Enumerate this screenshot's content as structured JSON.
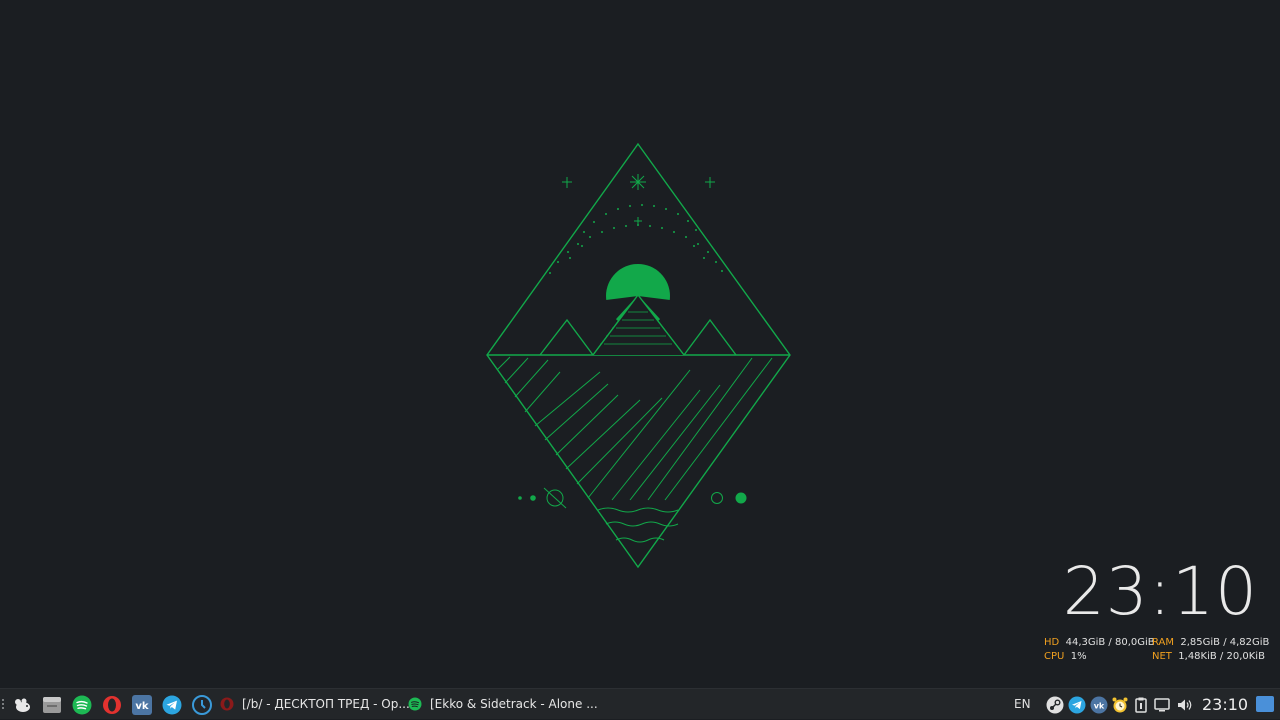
{
  "desktop": {
    "clock": "23:10",
    "sysmon": {
      "hd_label": "HD",
      "hd_value": "44,3GiB / 80,0GiB",
      "ram_label": "RAM",
      "ram_value": "2,85GiB / 4,82GiB",
      "cpu_label": "CPU",
      "cpu_value": "1%",
      "net_label": "NET",
      "net_value": "1,48KiB / 20,0KiB"
    },
    "wallpaper_accent": "#12a84a"
  },
  "taskbar": {
    "launchers": [
      {
        "name": "app-menu-icon"
      },
      {
        "name": "file-manager-icon"
      },
      {
        "name": "spotify-icon"
      },
      {
        "name": "opera-icon"
      },
      {
        "name": "vk-icon"
      },
      {
        "name": "telegram-icon"
      },
      {
        "name": "timeshift-icon"
      }
    ],
    "tasks": [
      {
        "icon": "opera-icon",
        "label": "[/b/ - ДЕСКТОП ТРЕД - Op..."
      },
      {
        "icon": "spotify-icon",
        "label": "[Ekko & Sidetrack - Alone ..."
      }
    ],
    "language": "EN",
    "tray": [
      "steam-icon",
      "telegram-icon",
      "vk-icon",
      "alarm-clock-icon",
      "clipboard-icon",
      "display-icon",
      "volume-icon"
    ],
    "clock": "23:10"
  }
}
